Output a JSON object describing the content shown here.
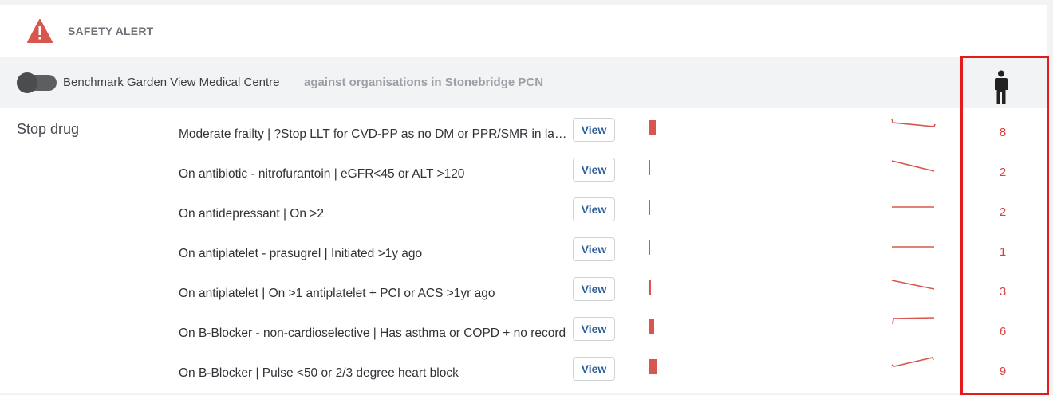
{
  "alert": {
    "title": "SAFETY ALERT",
    "icon": "warning-triangle-icon"
  },
  "benchmark": {
    "organisation": "Benchmark Garden View Medical Centre",
    "against": "against organisations in Stonebridge PCN",
    "toggle_icon": "toggle-switch-icon",
    "column_icon": "person-icon"
  },
  "group": {
    "label": "Stop drug"
  },
  "colors": {
    "accent": "#d9564f",
    "count": "#d6433b",
    "link": "#2d5f99",
    "highlight": "#e41b1b"
  },
  "rows": [
    {
      "label": "Moderate frailty | ?Stop LLT for CVD-PP as no DM or PPR/SMR in last yr",
      "button": "View",
      "count": "8"
    },
    {
      "label": "On antibiotic - nitrofurantoin | eGFR<45 or ALT >120",
      "button": "View",
      "count": "2"
    },
    {
      "label": "On antidepressant | On >2",
      "button": "View",
      "count": "2"
    },
    {
      "label": "On antiplatelet - prasugrel | Initiated >1y ago",
      "button": "View",
      "count": "1"
    },
    {
      "label": "On antiplatelet | On >1 antiplatelet + PCI or ACS >1yr ago",
      "button": "View",
      "count": "3"
    },
    {
      "label": "On B-Blocker - non-cardioselective | Has asthma or COPD + no record",
      "button": "View",
      "count": "6"
    },
    {
      "label": "On B-Blocker | Pulse <50 or 2/3 degree heart block",
      "button": "View",
      "count": "9"
    }
  ]
}
